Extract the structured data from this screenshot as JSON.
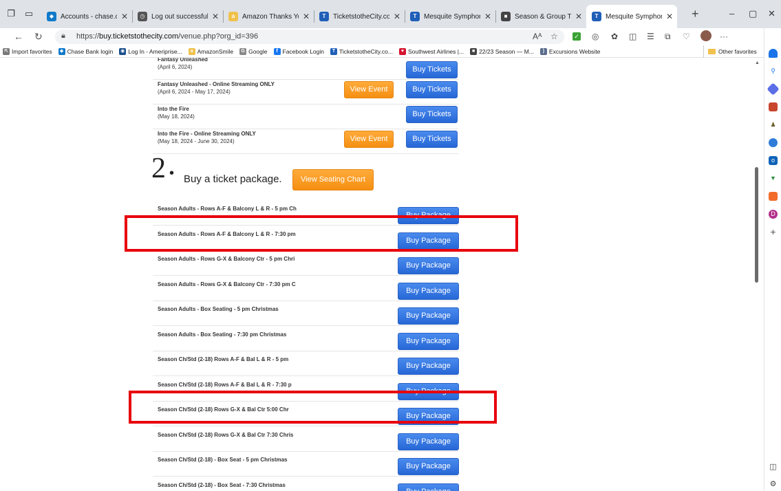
{
  "browser": {
    "tabs": [
      {
        "title": "Accounts - chase.com",
        "color": "#117aca",
        "glyph": "◆",
        "width": 132,
        "active": false
      },
      {
        "title": "Log out successful | Am",
        "color": "#555555",
        "glyph": "◷",
        "width": 132,
        "active": false
      },
      {
        "title": "Amazon Thanks You",
        "color": "#f0c14b",
        "glyph": "a",
        "width": 132,
        "active": false
      },
      {
        "title": "TicketstotheCity.com | T",
        "color": "#1f5fb8",
        "glyph": "T",
        "width": 132,
        "active": false
      },
      {
        "title": "Mesquite Symphony Or",
        "color": "#1f5fb8",
        "glyph": "T",
        "width": 132,
        "active": false
      },
      {
        "title": "Season & Group Ticket",
        "color": "#444444",
        "glyph": "■",
        "width": 132,
        "active": false
      },
      {
        "title": "Mesquite Symphony Or",
        "color": "#1f5fb8",
        "glyph": "T",
        "width": 132,
        "active": true
      }
    ],
    "url_scheme": "https://",
    "url_host": "buy.ticketstothecity.com",
    "url_path": "/venue.php?org_id=396",
    "favorites": [
      {
        "label": "Import favorites",
        "color": "#777777",
        "glyph": "⇱"
      },
      {
        "label": "Chase Bank login",
        "color": "#117aca",
        "glyph": "◆"
      },
      {
        "label": "Log In - Ameriprise...",
        "color": "#1b4d8c",
        "glyph": "◉"
      },
      {
        "label": "AmazonSmile",
        "color": "#f0c14b",
        "glyph": "a"
      },
      {
        "label": "Google",
        "color": "#888888",
        "glyph": "G"
      },
      {
        "label": "Facebook Login",
        "color": "#1877f2",
        "glyph": "f"
      },
      {
        "label": "TicketstotheCity.co...",
        "color": "#1f5fb8",
        "glyph": "T"
      },
      {
        "label": "Southwest Airlines |...",
        "color": "#d5152e",
        "glyph": "♥"
      },
      {
        "label": "22/23 Season — M...",
        "color": "#444444",
        "glyph": "■"
      },
      {
        "label": "Excursions Website",
        "color": "#5a6b8c",
        "glyph": ")"
      }
    ],
    "other_favorites": "Other favorites"
  },
  "events": [
    {
      "name": "Fantasy Unleashed",
      "date": "(April 6, 2024)",
      "view_event": false,
      "buy_label": "Buy Tickets"
    },
    {
      "name": "Fantasy Unleashed - Online Streaming ONLY",
      "date": "(April 6, 2024 - May 17, 2024)",
      "view_event": true,
      "buy_label": "Buy Tickets"
    },
    {
      "name": "Into the Fire",
      "date": "(May 18, 2024)",
      "view_event": false,
      "buy_label": "Buy Tickets"
    },
    {
      "name": "Into the Fire - Online Streaming ONLY",
      "date": "(May 18, 2024 - June 30, 2024)",
      "view_event": true,
      "buy_label": "Buy Tickets"
    }
  ],
  "view_event_label": "View Event",
  "step2": {
    "number": "2",
    "title": "Buy a ticket package.",
    "seating_chart_label": "View Seating Chart"
  },
  "packages": [
    {
      "name": "Season Adults - Rows A-F & Balcony L & R - 5 pm Ch",
      "button": "Buy Package"
    },
    {
      "name": "Season Adults - Rows A-F & Balcony L & R - 7:30 pm",
      "button": "Buy Package"
    },
    {
      "name": "Season Adults - Rows G-X & Balcony Ctr - 5 pm Chri",
      "button": "Buy Package"
    },
    {
      "name": "Season Adults - Rows G-X & Balcony Ctr - 7:30 pm C",
      "button": "Buy Package"
    },
    {
      "name": "Season Adults - Box Seating - 5 pm Christmas",
      "button": "Buy Package"
    },
    {
      "name": "Season Adults - Box Seating - 7:30 pm Christmas",
      "button": "Buy Package"
    },
    {
      "name": "Season Ch/Std (2-18) Rows A-F & Bal L & R - 5 pm",
      "button": "Buy Package"
    },
    {
      "name": "Season Ch/Std (2-18) Rows A-F & Bal L & R - 7:30 p",
      "button": "Buy Package"
    },
    {
      "name": "Season Ch/Std (2-18) Rows G-X & Bal Ctr 5:00 Chr",
      "button": "Buy Package"
    },
    {
      "name": "Season Ch/Std (2-18) Rows G-X & Bal Ctr 7:30 Chris",
      "button": "Buy Package"
    },
    {
      "name": "Season Ch/Std (2-18) - Box Seat - 5 pm Christmas",
      "button": "Buy Package"
    },
    {
      "name": "Season Ch/Std (2-18) - Box Seat - 7:30 Christmas",
      "button": "Buy Package"
    }
  ],
  "colors": {
    "highlight": "#e8000b",
    "button_blue": "#2f72e0",
    "button_orange": "#f7941d"
  }
}
